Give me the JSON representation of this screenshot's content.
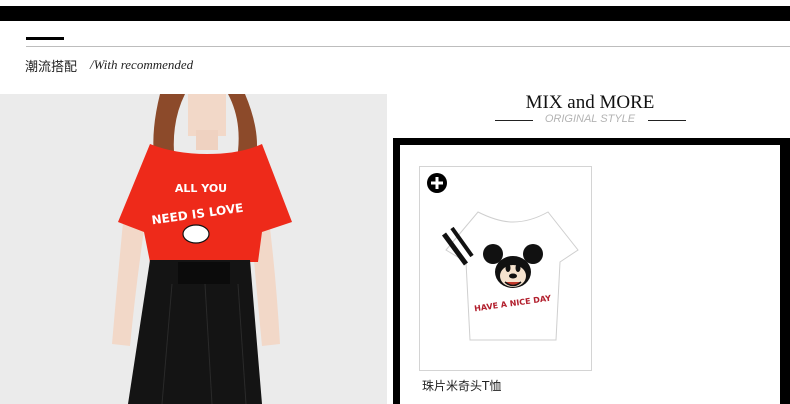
{
  "section": {
    "title": "潮流搭配",
    "subtitle": "/With recommended"
  },
  "photo": {
    "shirt_text_line1": "ALL YOU",
    "shirt_text_line2": "NEED IS LOVE",
    "colors": {
      "shirt": "#ee2a1a",
      "skirt": "#141414",
      "hair": "#8c4a2a"
    }
  },
  "mix": {
    "title": "MIX and MORE",
    "subtitle": "ORIGINAL STYLE"
  },
  "product": {
    "name": "珠片米奇头T恤",
    "add_icon": "plus-circle-icon",
    "print_text": "HAVE A NICE DAY"
  }
}
